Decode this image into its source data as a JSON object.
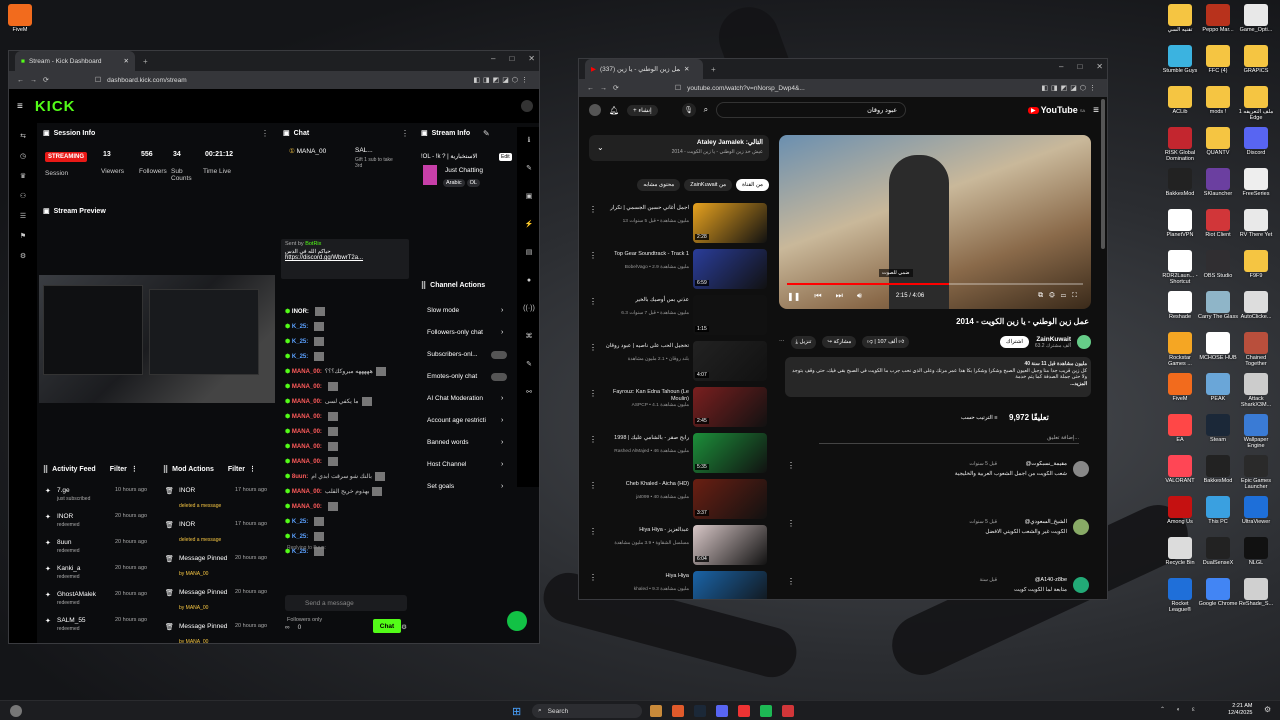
{
  "desktop_icons_left": [
    {
      "label": "FiveM",
      "color": "#f26b1d"
    }
  ],
  "desktop_icons_right": [
    {
      "label": "تقنيه السي",
      "color": "#f5c542"
    },
    {
      "label": "Peppo Mar...",
      "color": "#b8321c"
    },
    {
      "label": "Game_Opti...",
      "color": "#e8e8e8"
    },
    {
      "label": "Stumble Guys",
      "color": "#3bb3e0"
    },
    {
      "label": "FFC (4)",
      "color": "#f5c542"
    },
    {
      "label": "GRAPICS",
      "color": "#f5c542"
    },
    {
      "label": "ACLib",
      "color": "#f5c542"
    },
    {
      "label": "mods !",
      "color": "#f5c542"
    },
    {
      "label": "ملف التعريفه 1 Edge",
      "color": "#f5c542"
    },
    {
      "label": "RISK Global Domination",
      "color": "#c3262f"
    },
    {
      "label": "QUANTV",
      "color": "#f5c542"
    },
    {
      "label": "Discord",
      "color": "#5865f2"
    },
    {
      "label": "BakkesMod",
      "color": "#222"
    },
    {
      "label": "SKlauncher",
      "color": "#6b3fa0"
    },
    {
      "label": "FreeSeries",
      "color": "#eeeeee"
    },
    {
      "label": "PlanetVPN",
      "color": "#ffffff"
    },
    {
      "label": "Riot Client",
      "color": "#d13639"
    },
    {
      "label": "RV There Yet",
      "color": "#e9e9e9"
    },
    {
      "label": "RDR2Laun... - Shortcut",
      "color": "#ffffff"
    },
    {
      "label": "OBS Studio",
      "color": "#302e31"
    },
    {
      "label": "F9F9",
      "color": "#f5c542"
    },
    {
      "label": "Reshade",
      "color": "#ffffff"
    },
    {
      "label": "Carry The Glass",
      "color": "#8fb5c8"
    },
    {
      "label": "AutoClicke...",
      "color": "#dddddd"
    },
    {
      "label": "Rockstar Games ...",
      "color": "#f5a623"
    },
    {
      "label": "MCHOSE HUB",
      "color": "#ffffff"
    },
    {
      "label": "Chained Together",
      "color": "#b94f3c"
    },
    {
      "label": "FiveM",
      "color": "#f26b1d"
    },
    {
      "label": "PEAK",
      "color": "#6aa6d8"
    },
    {
      "label": "Attack SharkX3M...",
      "color": "#cccccc"
    },
    {
      "label": "EA",
      "color": "#ff4747"
    },
    {
      "label": "Steam",
      "color": "#1b2838"
    },
    {
      "label": "Wallpaper Engine",
      "color": "#3a7bd5"
    },
    {
      "label": "VALORANT",
      "color": "#ff4655"
    },
    {
      "label": "BakkesMod",
      "color": "#222"
    },
    {
      "label": "Epic Games Launcher",
      "color": "#2a2a2a"
    },
    {
      "label": "Among Us",
      "color": "#c51111"
    },
    {
      "label": "This PC",
      "color": "#3aa0e0"
    },
    {
      "label": "UltraViewer",
      "color": "#1e6fd9"
    },
    {
      "label": "Recycle Bin",
      "color": "#dcdcdc"
    },
    {
      "label": "DualSenseX",
      "color": "#222"
    },
    {
      "label": "NLGL",
      "color": "#111"
    },
    {
      "label": "Rocket League®",
      "color": "#1f6fd9"
    },
    {
      "label": "Google Chrome",
      "color": "#4285f4"
    },
    {
      "label": "ReShade_S...",
      "color": "#d0d0d0"
    }
  ],
  "kick": {
    "tab_title": "Stream - Kick Dashboard",
    "url": "dashboard.kick.com/stream",
    "logo": "KICK",
    "session": {
      "title": "Session Info",
      "status": "STREAMING",
      "session_label": "Session",
      "stats": [
        {
          "value": "13",
          "label": "Viewers"
        },
        {
          "value": "556",
          "label": "Followers"
        },
        {
          "value": "34",
          "label": "Sub Counts"
        },
        {
          "value": "00:21:12",
          "label": "Time Live"
        }
      ]
    },
    "preview_title": "Stream Preview",
    "chat": {
      "title": "Chat",
      "pinned_user": "MANA_00",
      "pinned_other": "SAL...",
      "pinned_note": "Gift 1 sub to take 3rd",
      "sent_by": "Sent by",
      "bot": "BotRix",
      "bot_msg": "حياكم الله في الدس",
      "bot_link": "https://discord.gg/WbwrT2a...",
      "lines": [
        {
          "user": "INOR:",
          "text": "",
          "color": "#ffffff"
        },
        {
          "user": "K_25:",
          "text": "",
          "color": "#5aa0ff"
        },
        {
          "user": "K_25:",
          "text": "",
          "color": "#5aa0ff"
        },
        {
          "user": "K_25:",
          "text": "",
          "color": "#5aa0ff"
        },
        {
          "user": "MANA_00:",
          "text": "هههههه ميروكك؟؟؟",
          "color": "#ff5b5b"
        },
        {
          "user": "MANA_00:",
          "text": "",
          "color": "#ff5b5b"
        },
        {
          "user": "MANA_00:",
          "text": "ما يكفي لسى",
          "color": "#ff5b5b"
        },
        {
          "user": "MANA_00:",
          "text": "",
          "color": "#ff5b5b"
        },
        {
          "user": "MANA_00:",
          "text": "",
          "color": "#ff5b5b"
        },
        {
          "user": "MANA_00:",
          "text": "",
          "color": "#ff5b5b"
        },
        {
          "user": "MANA_00:",
          "text": "",
          "color": "#ff5b5b"
        },
        {
          "user": "8uun:",
          "text": "بالنك شو سرقت ابدي ام",
          "color": "#ff5b5b"
        },
        {
          "user": "MANA_00:",
          "text": "بهذوم خريج القلب",
          "color": "#ff5b5b"
        },
        {
          "user": "MANA_00:",
          "text": "",
          "color": "#ff5b5b"
        },
        {
          "user": "K_25:",
          "text": "",
          "color": "#5aa0ff"
        },
        {
          "user": "K_25:",
          "text": "",
          "color": "#5aa0ff"
        },
        {
          "user": "K_25:",
          "text": "",
          "color": "#5aa0ff"
        }
      ],
      "replying": "Replying to 8uun:",
      "followers_only": "Followers only",
      "placeholder": "Send a message",
      "count": "0",
      "chat_button": "Chat"
    },
    "stream_info": {
      "title": "Stream Info",
      "stream_title": "!OL - !k ? | الاستخبارية",
      "edit": "Edit",
      "category": "Just Chatting",
      "tags": [
        "Arabic",
        "OL"
      ]
    },
    "channel_actions": {
      "title": "Channel Actions",
      "items": [
        "Slow mode",
        "Followers-only chat",
        "Subscribers-onl...",
        "Emotes-only chat",
        "AI Chat Moderation",
        "Account age restricti",
        "Banned words",
        "Host Channel",
        "Set goals"
      ]
    },
    "activity": {
      "title": "Activity Feed",
      "filter": "Filter",
      "items": [
        {
          "user": "7.ge",
          "action": "just subscribed",
          "time": "10 hours ago"
        },
        {
          "user": "INOR",
          "action": "redeemed",
          "time": "20 hours ago"
        },
        {
          "user": "8uun",
          "action": "redeemed",
          "time": "20 hours ago"
        },
        {
          "user": "Kanki_a",
          "action": "redeemed",
          "time": "20 hours ago"
        },
        {
          "user": "GhostAMalek",
          "action": "redeemed",
          "time": "20 hours ago"
        },
        {
          "user": "SALM_55",
          "action": "redeemed",
          "time": "20 hours ago"
        }
      ]
    },
    "mod": {
      "title": "Mod Actions",
      "filter": "Filter",
      "items": [
        {
          "user": "INOR",
          "action": "deleted a message",
          "time": "17 hours ago",
          "by": ""
        },
        {
          "user": "INOR",
          "action": "deleted a message",
          "time": "17 hours ago",
          "by": ""
        },
        {
          "user": "Message Pinned",
          "action": "by MANA_00",
          "time": "20 hours ago",
          "by": ""
        },
        {
          "user": "Message Pinned",
          "action": "by MANA_00",
          "time": "20 hours ago",
          "by": ""
        },
        {
          "user": "Message Pinned",
          "action": "by MANA_00",
          "time": "20 hours ago",
          "by": ""
        }
      ]
    }
  },
  "yt": {
    "tab_title": "(337) عمل زين الوطني - يا زين...",
    "url": "youtube.com/watch?v=nNorsp_Dwp4&...",
    "search": "عبود روقان",
    "brand": "YouTube",
    "badge": "SA",
    "playlist": {
      "title": "Ataley Jamalek :التالي",
      "sub": "عيش خذ زين الوطني - يا زين الكويت - 2014"
    },
    "chips": [
      "من القناة",
      "ZainKuwait من",
      "محتوى مشابه"
    ],
    "video_title": "عمل زين الوطني - يا زين الكويت - 2014",
    "time": "2:15 / 4:06",
    "caption": "ضمي للصوت",
    "channel": "ZainKuwait",
    "subs": "63.2 ألف مشترك",
    "join": "اشتراك",
    "likes": "107 ألف",
    "share": "مشاركة",
    "download": "تنزيل",
    "desc_head": "40 مليون مشاهدة  قبل 11 سنة",
    "desc": "كل زين قريب جدا منا وجبل العيون الصبح وشكرا وشكرا بكا هذا عمر مرتك وعلى الذي نحب جرب ما الكويت في الصبح بقي فيك، حتى وقف بتوجد ولا حتى جملة الصدفة كما يتم خدمة",
    "more": "...المزيد",
    "comments_count": "9,972 تعليقًا",
    "sort": "الترتيب حسب",
    "add_comment": "إضافة تعليق...",
    "comments": [
      {
        "user": "@مقيمة_نسبكوت",
        "time": "قبل 5 سنوات",
        "text": "شعب الكويت من اجمل الشعوب العربية والخليجية"
      },
      {
        "user": "@الشيخ_السعودي",
        "time": "قبل 5 سنوات",
        "text": "الكويت غير والشعب الكويتي الافضل"
      },
      {
        "user": "@A140-z8be",
        "time": "قبل سنة",
        "text": "متابعة لما الكويت كويت"
      }
    ],
    "recs": [
      {
        "title": "اجمل أغاني حسين الجسمي | تكرار",
        "sub": "13 مليون مشاهدة • قبل 5 سنوات",
        "dur": "2:28",
        "color": "#e7a21f"
      },
      {
        "title": "Top Gear Soundtrack - Track 1",
        "sub": "BobelVago • 2.9 مليون مشاهدة",
        "dur": "6:59",
        "color": "#2a3d9a"
      },
      {
        "title": "عذني بس أوصيك بالخير",
        "sub": "6.3 مليون مشاهدة • قبل 7 سنوات",
        "dur": "1:15",
        "color": "#111111"
      },
      {
        "title": "تخجيل الحب على ناصيه | عبود روقان",
        "sub": "بلند روقان • 2.1 مليون مشاهدة",
        "dur": "4:07",
        "color": "#222222"
      },
      {
        "title": "Fayrouz: Kan Edna Tahoun (Le Moulin)",
        "sub": "ASPCP • 4.1 مليون مشاهدة",
        "dur": "2:45",
        "color": "#7a1f1f"
      },
      {
        "title": "رابح صقر - بالشامي عليك | 1998",
        "sub": "Rashed AlMajed • 46 مليون مشاهدة",
        "dur": "5:35",
        "color": "#1c8f3a"
      },
      {
        "title": "Cheb Khaled - Aicha (HD)",
        "sub": "jat099 • 40 مليون مشاهدة",
        "dur": "3:37",
        "color": "#6a1f12"
      },
      {
        "title": "Hiya Hiya - عبدالعزيز",
        "sub": "مسلسل الشقاوة • 3.9 مليون مشاهدة",
        "dur": "6:04",
        "color": "#d8c7c7"
      },
      {
        "title": "Hiya Hiya",
        "sub": "khaled • 9.3 مليون مشاهدة",
        "dur": "",
        "color": "#1a64a8"
      }
    ]
  },
  "taskbar": {
    "search": "Search",
    "time": "2:21 AM",
    "date": "12/4/2025",
    "lang": "ENG"
  }
}
